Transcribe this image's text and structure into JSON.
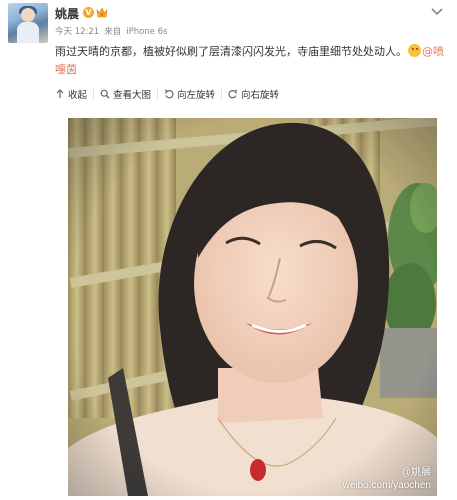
{
  "post": {
    "username": "姚晨",
    "v_badge": "V",
    "time": "今天 12:21",
    "source_prefix": "来自",
    "source": "iPhone 6s",
    "text": "雨过天晴的京都，植被好似刷了层清漆闪闪发光，寺庙里细节处处动人。",
    "mention": "@喷嚏茵"
  },
  "toolbar": {
    "collapse": "收起",
    "view_large": "查看大图",
    "rotate_left": "向左旋转",
    "rotate_right": "向右旋转"
  },
  "photo": {
    "watermark_handle": "@姚晨",
    "watermark_url": "weibo.com/yaochen"
  },
  "colors": {
    "link": "#eb7350",
    "text": "#333333",
    "meta": "#888888",
    "vip_badge": "#f5a623"
  },
  "icons": [
    "avatar",
    "verified-v-icon",
    "vip-crown-icon",
    "chevron-down-icon",
    "smile-emoji-icon",
    "collapse-up-icon",
    "search-magnifier-icon",
    "rotate-left-icon",
    "rotate-right-icon"
  ]
}
